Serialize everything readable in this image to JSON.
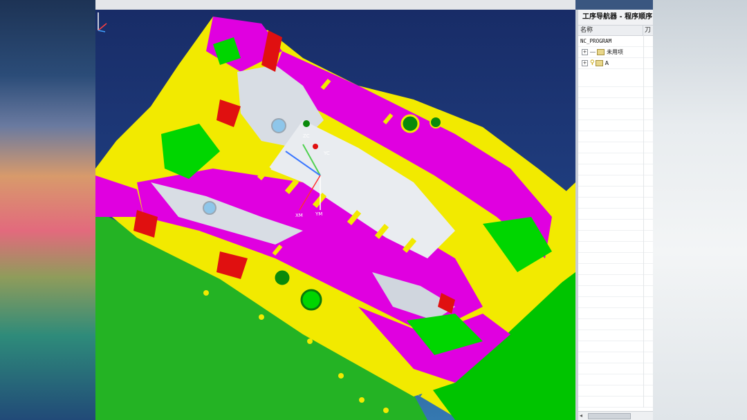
{
  "navigator": {
    "title": "工序导航器 - 程序顺序",
    "columns": {
      "name": "名称",
      "tool": "刀"
    },
    "rows": [
      {
        "label": "NC_PROGRAM",
        "level": 0
      },
      {
        "label": "未用项",
        "level": 1,
        "expand": "+"
      },
      {
        "label": "A",
        "level": 1,
        "expand": "+",
        "icon": "key-icon"
      }
    ]
  },
  "viewport": {
    "axis_labels": {
      "zc": "ZC",
      "yc": "YC",
      "xm": "XM",
      "ym": "YM"
    },
    "colors": {
      "background_top": "#182c67",
      "magenta": "#e000e0",
      "yellow": "#f2ea00",
      "green": "#00d600",
      "red": "#e01010",
      "silver": "#d8dde4"
    }
  }
}
